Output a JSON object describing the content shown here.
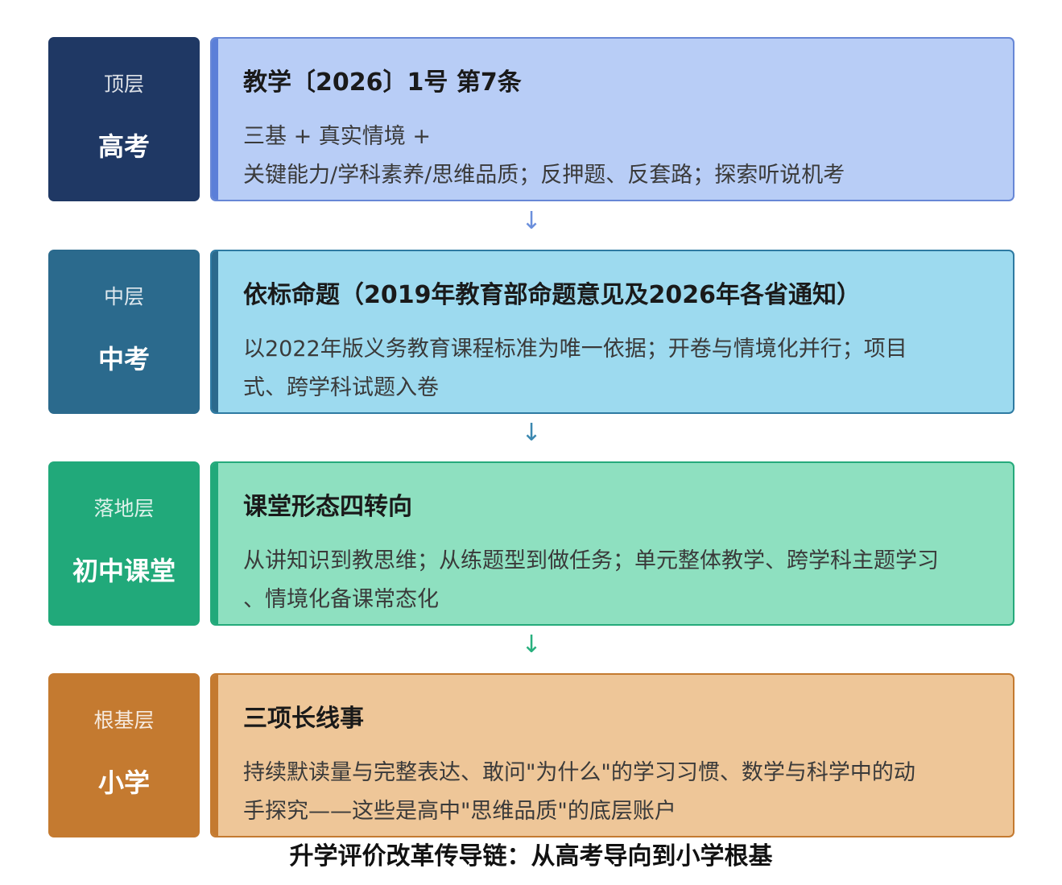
{
  "rows": [
    {
      "tier": "顶层",
      "name": "高考",
      "title": "教学〔2026〕1号 第7条",
      "lines": [
        "三基 + 真实情境 +",
        "关键能力/学科素养/思维品质；反押题、反套路；探索听说机考"
      ],
      "colors": {
        "level": "#1f3864",
        "card": "#b8cdf6",
        "border": "#6787d6",
        "bar": "#5b7fd8"
      }
    },
    {
      "tier": "中层",
      "name": "中考",
      "title": "依标命题（2019年教育部命题意见及2026年各省通知）",
      "lines": [
        "以2022年版义务教育课程标准为唯一依据；开卷与情境化并行；项目",
        "式、跨学科试题入卷"
      ],
      "colors": {
        "level": "#2b6a8d",
        "card": "#9ddaef",
        "border": "#2e7aa2",
        "bar": "#2b6a8d"
      }
    },
    {
      "tier": "落地层",
      "name": "初中课堂",
      "title": "课堂形态四转向",
      "lines": [
        "从讲知识到教思维；从练题型到做任务；单元整体教学、跨学科主题学习",
        "、情境化备课常态化"
      ],
      "colors": {
        "level": "#21a97a",
        "card": "#8ee0c0",
        "border": "#25aa7b",
        "bar": "#21a97a"
      }
    },
    {
      "tier": "根基层",
      "name": "小学",
      "title": "三项长线事",
      "lines": [
        "持续默读量与完整表达、敢问\"为什么\"的学习习惯、数学与科学中的动",
        "手探究——这些是高中\"思维品质\"的底层账户"
      ],
      "colors": {
        "level": "#c47a30",
        "card": "#eec698",
        "border": "#c47a30",
        "bar": "#c47a30"
      }
    }
  ],
  "arrows": [
    {
      "glyph": "↓",
      "color": "#6b8fdc"
    },
    {
      "glyph": "↓",
      "color": "#3b88b0"
    },
    {
      "glyph": "↓",
      "color": "#28b07e"
    }
  ],
  "caption": "升学评价改革传导链：从高考导向到小学根基"
}
